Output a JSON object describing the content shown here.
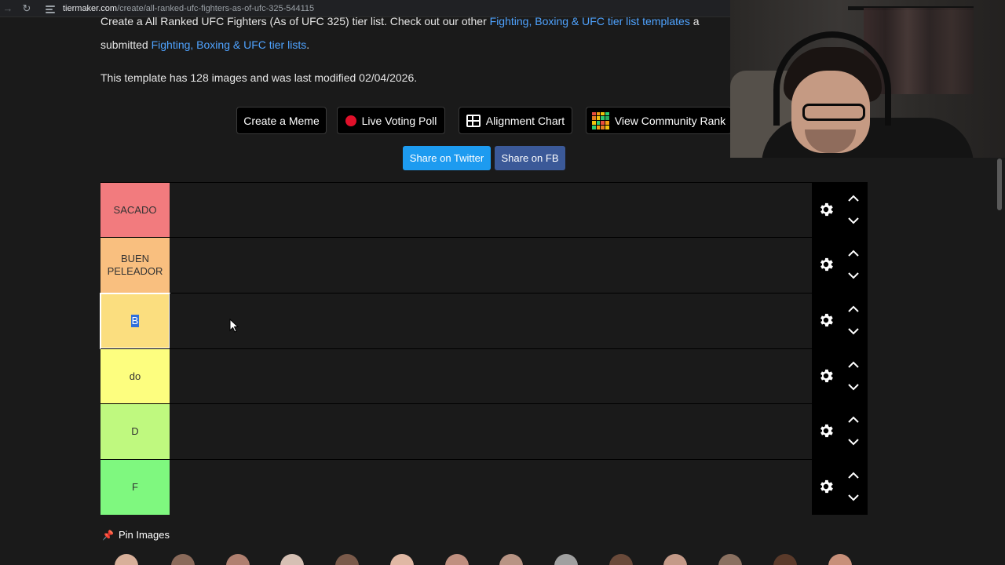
{
  "browser": {
    "url_domain": "tiermaker.com",
    "url_path": "/create/all-ranked-ufc-fighters-as-of-ufc-325-544115"
  },
  "intro": {
    "line1_start": "Create a All Ranked UFC Fighters (As of UFC 325) tier list. Check out our other ",
    "line1_link": "Fighting, Boxing & UFC tier list templates",
    "line1_end": " a",
    "line2_start": "submitted ",
    "line2_link": "Fighting, Boxing & UFC tier lists",
    "line2_end": "."
  },
  "meta_text": "This template has 128 images and was last modified 02/04/2026.",
  "actions": {
    "create_meme": "Create a Meme",
    "live_poll": "Live Voting Poll",
    "alignment": "Alignment Chart",
    "community": "View Community Rank"
  },
  "share": {
    "twitter": "Share on Twitter",
    "fb": "Share on FB"
  },
  "tiers": [
    {
      "label": "SACADO",
      "color": "#f27b7e"
    },
    {
      "label_line1": "BUEN",
      "label_line2": "PELEADOR",
      "color": "#f9bf7f"
    },
    {
      "label": "B",
      "color": "#fbde7f"
    },
    {
      "label": "do",
      "color": "#fdfe7f"
    },
    {
      "label": "D",
      "color": "#bff97f"
    },
    {
      "label": "F",
      "color": "#7ff87f"
    }
  ],
  "pin_images": "Pin Images",
  "colors": {
    "page_bg": "#1a1a1a",
    "link": "#4fa3ff",
    "twitter": "#1d9bf0",
    "facebook": "#3b5998",
    "live_dot": "#e0102a"
  }
}
